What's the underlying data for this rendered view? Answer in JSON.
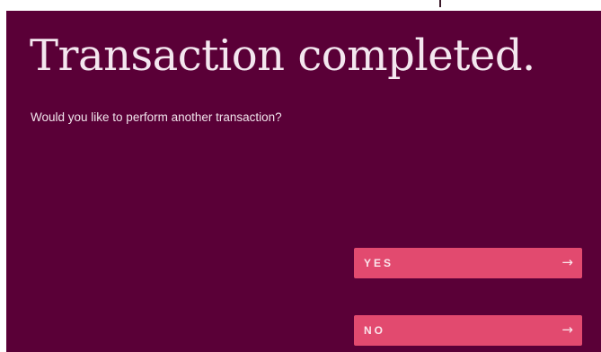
{
  "screen": {
    "title": "Transaction completed.",
    "question": "Would you like to perform another transaction?"
  },
  "actions": {
    "yes_label": "YES",
    "no_label": "NO",
    "arrow_glyph": "→",
    "arrow_icon": "arrow-right-icon"
  },
  "colors": {
    "background": "#5a0037",
    "button": "#e24a6f",
    "text": "#f4e7ef"
  }
}
